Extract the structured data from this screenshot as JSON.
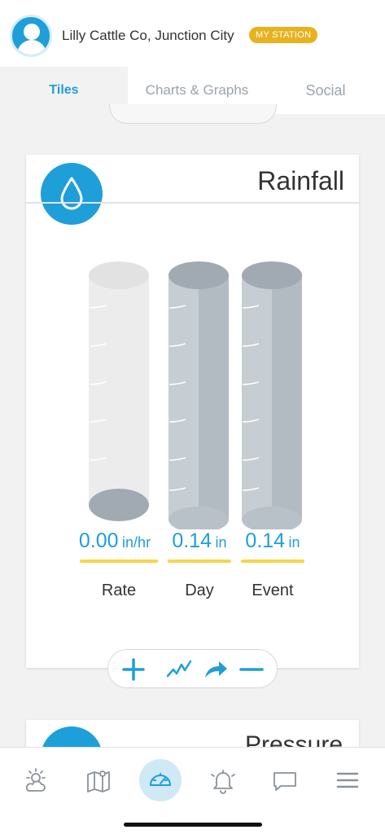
{
  "header": {
    "station_name": "Lilly Cattle Co, Junction City",
    "badge": "MY STATION",
    "avatar_icon": "user-avatar-icon"
  },
  "tabs": [
    {
      "label": "Tiles",
      "active": true
    },
    {
      "label": "Charts & Graphs",
      "active": false
    },
    {
      "label": "Social",
      "active": false
    }
  ],
  "rainfall_card": {
    "title": "Rainfall",
    "icon": "raindrop-icon",
    "gauges": [
      {
        "label": "Rate",
        "value": "0.00",
        "unit": "in/hr"
      },
      {
        "label": "Day",
        "value": "0.14",
        "unit": "in"
      },
      {
        "label": "Event",
        "value": "0.14",
        "unit": "in"
      }
    ],
    "actions": [
      "add-icon",
      "trend-chart-icon",
      "share-icon",
      "minus-icon"
    ]
  },
  "pressure_card": {
    "title": "Pressure",
    "icon": "pressure-gauge-icon"
  },
  "bottom_nav": [
    {
      "icon": "weather-icon",
      "active": false
    },
    {
      "icon": "map-icon",
      "active": false
    },
    {
      "icon": "dashboard-gauge-icon",
      "active": true
    },
    {
      "icon": "bell-icon",
      "active": false
    },
    {
      "icon": "chat-icon",
      "active": false
    },
    {
      "icon": "menu-icon",
      "active": false
    }
  ],
  "colors": {
    "accent": "#1e9fd9",
    "badge": "#e8b21f",
    "underline": "#f5d54a",
    "cylinder_full": "#b9c1c8",
    "cylinder_empty": "#ececec"
  }
}
